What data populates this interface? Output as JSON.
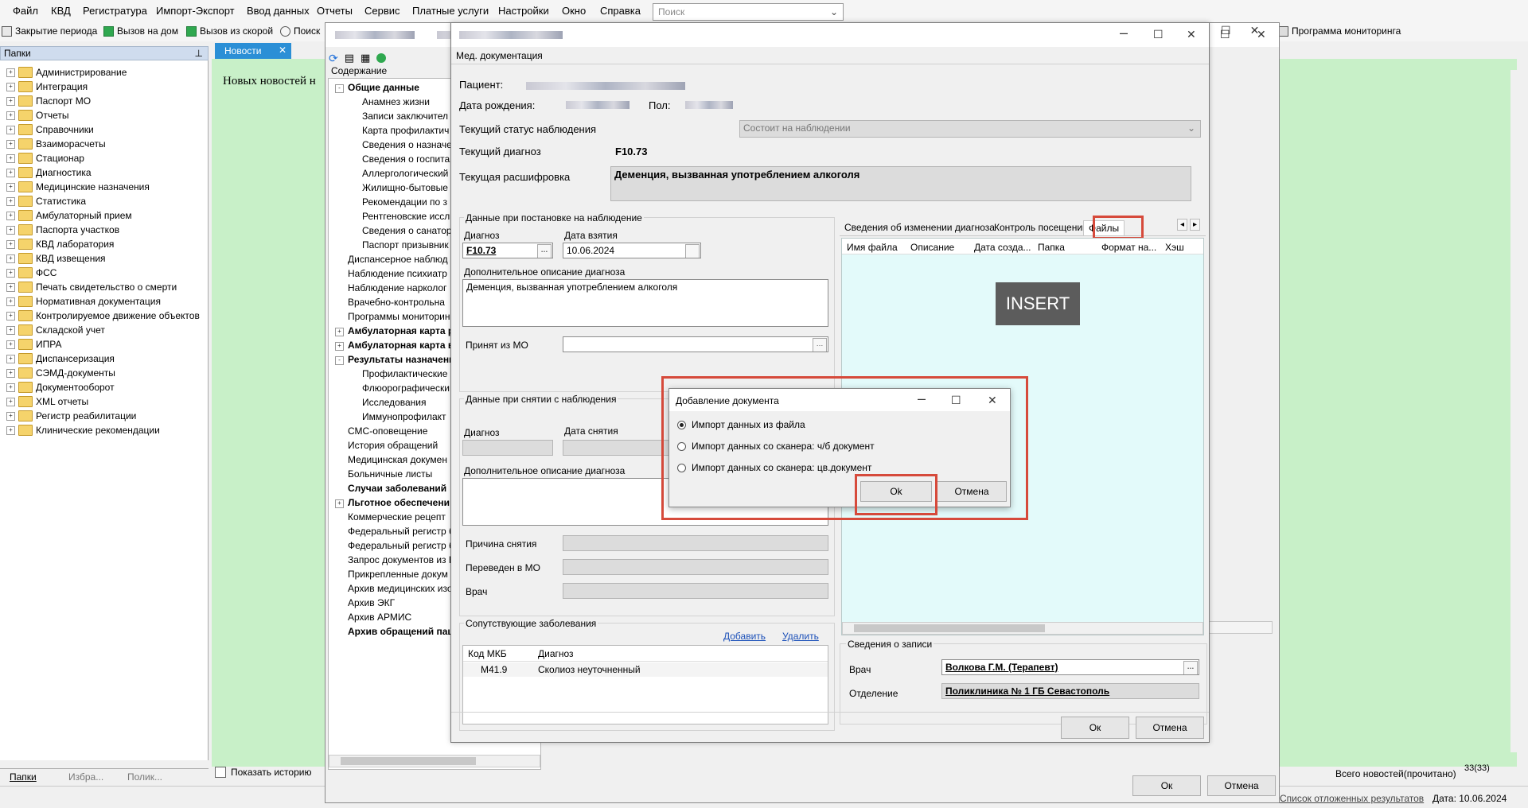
{
  "menu": [
    "Файл",
    "КВД",
    "Регистратура",
    "Импорт-Экспорт",
    "Ввод данных",
    "Отчеты",
    "Сервис",
    "Платные услуги",
    "Настройки",
    "Окно",
    "Справка"
  ],
  "search_placeholder": "Поиск",
  "toolbar": [
    "Закрытие периода",
    "Вызов на дом",
    "Вызов из скорой",
    "Поиск"
  ],
  "monitoring_label": "Программа мониторинга",
  "left_panel": {
    "title": "Папки",
    "folders": [
      "Администрирование",
      "Интеграция",
      "Паспорт МО",
      "Отчеты",
      "Справочники",
      "Взаиморасчеты",
      "Стационар",
      "Диагностика",
      "Медицинские назначения",
      "Статистика",
      "Амбулаторный прием",
      "Паспорта участков",
      "КВД лаборатория",
      "КВД извещения",
      "ФСС",
      "Печать свидетельство о смерти",
      "Нормативная документация",
      "Контролируемое движение объектов",
      "Складской учет",
      "ИПРА",
      "Диспансеризация",
      "СЭМД-документы",
      "Документооборот",
      "XML отчеты",
      "Регистр реабилитации",
      "Клинические рекомендации"
    ],
    "bottom_tabs": [
      "Папки",
      "Избра...",
      "Полик..."
    ]
  },
  "news": {
    "tab": "Новости",
    "text": "Новых новостей н",
    "show_history": "Показать историю",
    "total_label": "Всего новостей(прочитано)",
    "total_value": "33(33)",
    "ok": "Ок",
    "cancel": "Отмена"
  },
  "footer": {
    "deferred": "Список отложенных результатов",
    "date": "Дата: 10.06.2024"
  },
  "content_tree": {
    "label": "Содержание",
    "items": [
      {
        "text": "Общие данные",
        "bold": true,
        "lvl": 0,
        "exp": "-"
      },
      {
        "text": "Анамнез жизни",
        "lvl": 1
      },
      {
        "text": "Записи заключител",
        "lvl": 1
      },
      {
        "text": "Карта профилактич",
        "lvl": 1
      },
      {
        "text": "Сведения о назначе",
        "lvl": 1
      },
      {
        "text": "Сведения о госпита",
        "lvl": 1
      },
      {
        "text": "Аллергологический",
        "lvl": 1
      },
      {
        "text": "Жилищно-бытовые",
        "lvl": 1
      },
      {
        "text": "Рекомендации по з",
        "lvl": 1
      },
      {
        "text": "Рентгеновские иссл",
        "lvl": 1
      },
      {
        "text": "Сведения о санатор",
        "lvl": 1
      },
      {
        "text": "Паспорт призывник",
        "lvl": 1
      },
      {
        "text": "Диспансерное наблюд",
        "lvl": 0
      },
      {
        "text": "Наблюдение психиатр",
        "lvl": 0
      },
      {
        "text": "Наблюдение нарколог",
        "lvl": 0
      },
      {
        "text": "Врачебно-контрольна",
        "lvl": 0
      },
      {
        "text": "Программы мониторин",
        "lvl": 0
      },
      {
        "text": "Амбулаторная карта р",
        "bold": true,
        "lvl": 0,
        "exp": "+"
      },
      {
        "text": "Амбулаторная карта в",
        "bold": true,
        "lvl": 0,
        "exp": "+"
      },
      {
        "text": "Результаты назначени",
        "bold": true,
        "lvl": 0,
        "exp": "-"
      },
      {
        "text": "Профилактические",
        "lvl": 1
      },
      {
        "text": "Флюорографически",
        "lvl": 1
      },
      {
        "text": "Исследования",
        "lvl": 1
      },
      {
        "text": "Иммунопрофилакт",
        "lvl": 1
      },
      {
        "text": "СМС-оповещение",
        "lvl": 0
      },
      {
        "text": "История обращений",
        "lvl": 0
      },
      {
        "text": "Медицинская докумен",
        "lvl": 0
      },
      {
        "text": "Больничные листы",
        "lvl": 0
      },
      {
        "text": "Случаи заболеваний",
        "bold": true,
        "lvl": 0
      },
      {
        "text": "Льготное обеспечени",
        "bold": true,
        "lvl": 0,
        "exp": "+"
      },
      {
        "text": "Коммерческие рецепт",
        "lvl": 0
      },
      {
        "text": "Федеральный регистр б",
        "lvl": 0
      },
      {
        "text": "Федеральный регистр б",
        "lvl": 0
      },
      {
        "text": "Запрос документов из Е",
        "lvl": 0
      },
      {
        "text": "Прикрепленные докум",
        "lvl": 0
      },
      {
        "text": "Архив медицинских изо",
        "lvl": 0
      },
      {
        "text": "Архив ЭКГ",
        "lvl": 0
      },
      {
        "text": "Архив АРМИС",
        "lvl": 0
      },
      {
        "text": "Архив обращений пац",
        "bold": true,
        "lvl": 0
      }
    ]
  },
  "med_doc": {
    "subtitle": "Мед. документация",
    "patient_label": "Пациент:",
    "dob_label": "Дата рождения:",
    "sex_label": "Пол:",
    "status_label": "Текущий статус наблюдения",
    "status_value": "Состоит на наблюдении",
    "diag_label": "Текущий диагноз",
    "diag_value": "F10.73",
    "decode_label": "Текущая расшифровка",
    "decode_value": "Деменция, вызванная употреблением алкоголя",
    "reg_group": "Данные при постановке на наблюдение",
    "diag_field_label": "Диагноз",
    "diag_field_value": "F10.73",
    "date_taken_label": "Дата взятия",
    "date_taken_value": "10.06.2024",
    "extra_desc_label": "Дополнительное описание диагноза",
    "extra_desc_value": "Деменция, вызванная употреблением алкоголя",
    "accepted_from_label": "Принят из МО",
    "remove_group": "Данные при снятии с наблюдения",
    "remove_diag_label": "Диагноз",
    "remove_date_label": "Дата снятия",
    "remove_extra_label": "Дополнительное описание диагноза",
    "reason_label": "Причина снятия",
    "transferred_label": "Переведен в МО",
    "doctor_label": "Врач",
    "comorb_group": "Сопутствующие заболевания",
    "add_link": "Добавить",
    "delete_link": "Удалить",
    "comorb_headers": [
      "Код МКБ",
      "Диагноз"
    ],
    "comorb_rows": [
      [
        "M41.9",
        "Сколиоз неуточненный"
      ]
    ],
    "tabs": [
      "Сведения об изменении диагноза",
      "Контроль посещений",
      "Файлы"
    ],
    "files_headers": [
      "Имя файла",
      "Описание",
      "Дата созда...",
      "Папка",
      "Формат на...",
      "Хэш"
    ],
    "insert_label": "INSERT",
    "record_group": "Сведения о записи",
    "rec_doctor_label": "Врач",
    "rec_doctor_value": "Волкова Г.М. (Терапевт)",
    "dept_label": "Отделение",
    "dept_value": "Поликлиника № 1 ГБ Севастополь",
    "ok": "Ок",
    "cancel": "Отмена"
  },
  "add_doc": {
    "title": "Добавление документа",
    "options": [
      "Импорт данных из файла",
      "Импорт данных со сканера: ч/б документ",
      "Импорт данных со сканера: цв.документ"
    ],
    "selected": 0,
    "ok": "Ok",
    "cancel": "Отмена"
  },
  "colors": {
    "highlight": "#d64a3b",
    "news_tab": "#2b8fd6",
    "green_bg": "#c8f0c8",
    "files_bg": "#e3fafa"
  }
}
